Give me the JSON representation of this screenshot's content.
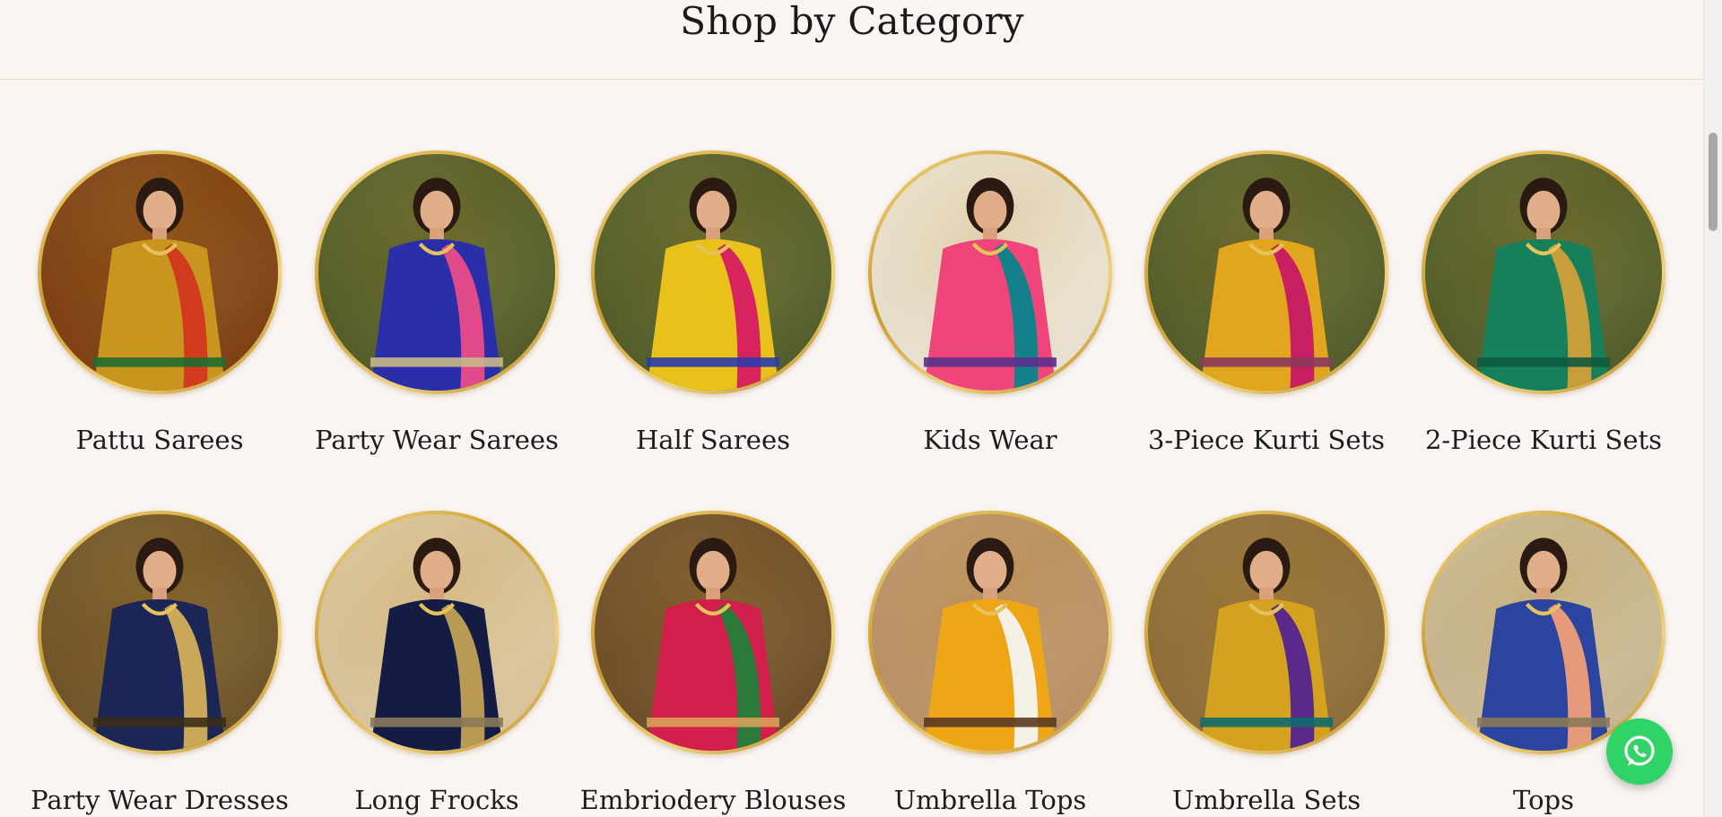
{
  "section": {
    "title": "Shop by Category"
  },
  "categories": [
    {
      "label": "Pattu Sarees",
      "icon": "pattu-saree-photo",
      "colors": [
        "#7a3b12",
        "#c8961e",
        "#d23b1e",
        "#1e6b2c"
      ]
    },
    {
      "label": "Party Wear Sarees",
      "icon": "party-wear-saree-photo",
      "colors": [
        "#4d5a2a",
        "#2a2ea8",
        "#e14a8a",
        "#c8b88a"
      ]
    },
    {
      "label": "Half Sarees",
      "icon": "half-saree-photo",
      "colors": [
        "#4d5a2a",
        "#e8c21a",
        "#d8245e",
        "#2b3aa8"
      ]
    },
    {
      "label": "Kids Wear",
      "icon": "kids-wear-photo",
      "colors": [
        "#e9e2d6",
        "#f0457a",
        "#13808a",
        "#5a2f8a"
      ]
    },
    {
      "label": "3-Piece Kurti Sets",
      "icon": "three-piece-kurti-photo",
      "colors": [
        "#4d5a2a",
        "#e2a51e",
        "#c81e62",
        "#8a3a5a"
      ]
    },
    {
      "label": "2-Piece Kurti Sets",
      "icon": "two-piece-kurti-photo",
      "colors": [
        "#4d5a2a",
        "#16805a",
        "#c89e3a",
        "#0f5a3e"
      ]
    },
    {
      "label": "Party Wear Dresses",
      "icon": "party-wear-dress-photo",
      "colors": [
        "#6a5028",
        "#1c2656",
        "#c9a85a",
        "#3a2e18"
      ]
    },
    {
      "label": "Long Frocks",
      "icon": "long-frock-photo",
      "colors": [
        "#d8c4a0",
        "#141c44",
        "#b89a54",
        "#8a7a5a"
      ]
    },
    {
      "label": "Embriodery Blouses",
      "icon": "embroidery-blouse-photo",
      "colors": [
        "#6a4a2a",
        "#d21e4a",
        "#2c7a3a",
        "#d8a05a"
      ]
    },
    {
      "label": "Umbrella Tops",
      "icon": "umbrella-top-photo",
      "colors": [
        "#b8906a",
        "#eea616",
        "#f4f0e6",
        "#5a3a22"
      ]
    },
    {
      "label": "Umbrella Sets",
      "icon": "umbrella-set-photo",
      "colors": [
        "#8a6a3a",
        "#d4a21e",
        "#5a2a8a",
        "#0e6a6a"
      ]
    },
    {
      "label": "Tops",
      "icon": "tops-photo",
      "colors": [
        "#c8b898",
        "#2a44a0",
        "#e59a7a",
        "#8a7a5a"
      ]
    }
  ],
  "whatsapp": {
    "icon": "whatsapp-icon",
    "color": "#2fd366"
  },
  "scrollbar": {
    "icon": "scrollbar"
  }
}
